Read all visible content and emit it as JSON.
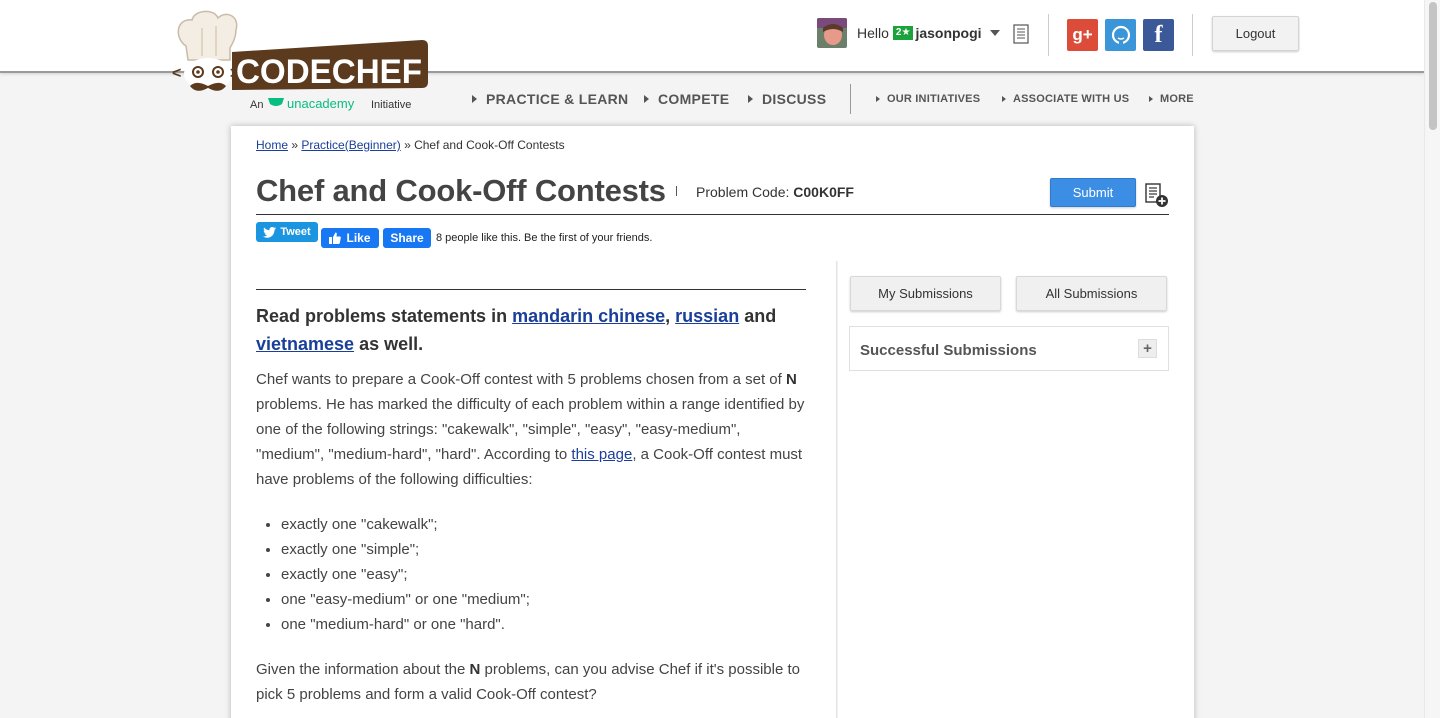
{
  "header": {
    "logo_text": "CODECHEF",
    "logo_tagline_prefix": "An",
    "logo_tagline_brand": "unacademy",
    "logo_tagline_suffix": "Initiative",
    "greeting": "Hello",
    "user_star": "2★",
    "username": "jasonpogi",
    "gplus_label": "g+",
    "facebook_label": "f",
    "logout_label": "Logout"
  },
  "nav": {
    "main": [
      "PRACTICE & LEARN",
      "COMPETE",
      "DISCUSS"
    ],
    "secondary": [
      "OUR INITIATIVES",
      "ASSOCIATE WITH US",
      "MORE"
    ]
  },
  "breadcrumb": {
    "home": "Home",
    "sep1": " » ",
    "practice": "Practice(Beginner)",
    "sep2": " » ",
    "current": "Chef and Cook-Off Contests"
  },
  "problem": {
    "title": "Chef and Cook-Off Contests",
    "code_label": "Problem Code:",
    "code": "C00K0FF",
    "submit_label": "Submit"
  },
  "share": {
    "tweet_label": "Tweet",
    "like_label": "Like",
    "share_label": "Share",
    "like_text": "8 people like this. Be the first of your friends."
  },
  "statement": {
    "lang_prefix": "Read problems statements in ",
    "lang_1": "mandarin chinese",
    "lang_sep": ", ",
    "lang_2": "russian",
    "lang_and": " and ",
    "lang_3": "vietnamese",
    "lang_suffix": " as well.",
    "p1_a": "Chef wants to prepare a Cook-Off contest with 5 problems chosen from a set of ",
    "p1_n": "N",
    "p1_b": " problems. He has marked the difficulty of each problem within a range identified by one of the following strings: \"cakewalk\", \"simple\", \"easy\", \"easy-medium\", \"medium\", \"medium-hard\", \"hard\". According to ",
    "p1_link": "this page",
    "p1_c": ", a Cook-Off contest must have problems of the following difficulties:",
    "conditions": [
      "exactly one \"cakewalk\";",
      "exactly one \"simple\";",
      "exactly one \"easy\";",
      "one \"easy-medium\" or one \"medium\";",
      "one \"medium-hard\" or one \"hard\"."
    ],
    "p2_a": "Given the information about the ",
    "p2_n": "N",
    "p2_b": " problems, can you advise Chef if it's possible to pick 5 problems and form a valid Cook-Off contest?"
  },
  "sidebar": {
    "my_submissions": "My Submissions",
    "all_submissions": "All Submissions",
    "successful_submissions": "Successful Submissions",
    "expand_symbol": "+"
  },
  "colors": {
    "brand_brown": "#5b3a1e",
    "submit_blue": "#3b8ee4",
    "link_blue": "#1a3f9a",
    "unacademy_green": "#08bd80"
  }
}
